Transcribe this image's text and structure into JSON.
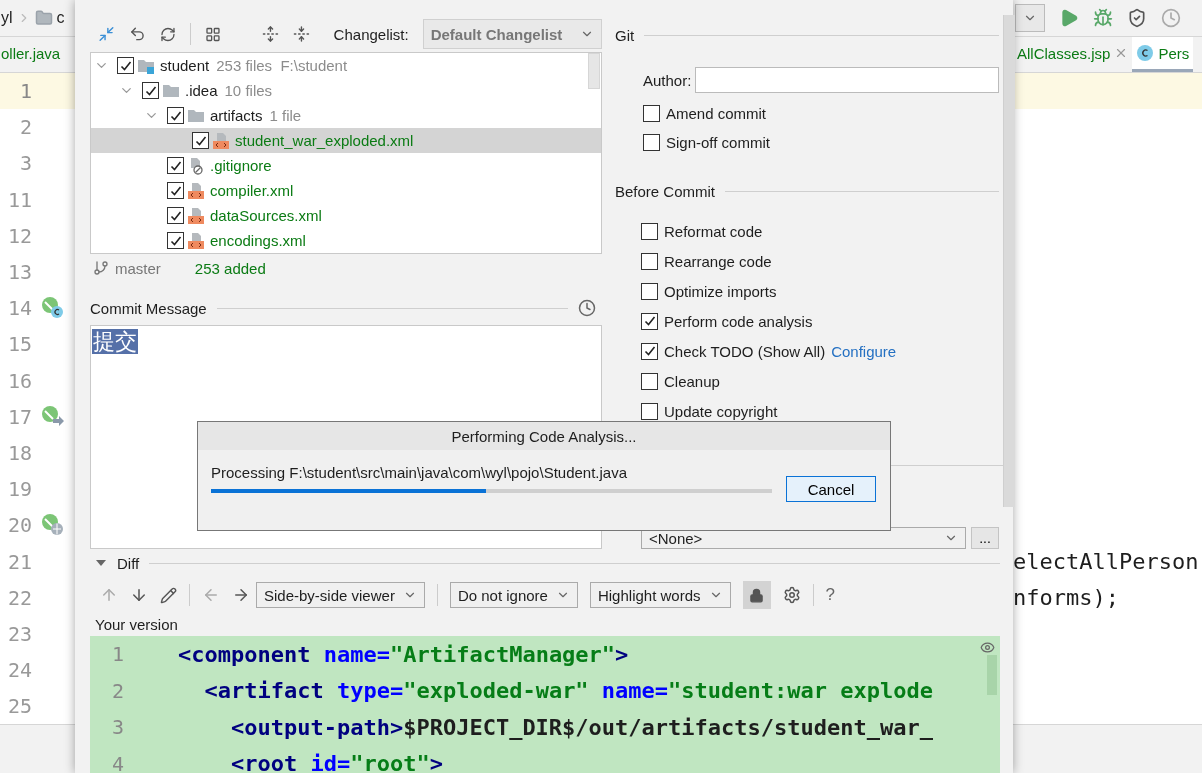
{
  "ide": {
    "breadcrumb": [
      {
        "label": "yl",
        "kind": "text"
      },
      {
        "label": "c",
        "kind": "folder"
      }
    ],
    "left_tab": "oller.java",
    "right_tabs": [
      {
        "label": "AllClasses.jsp",
        "selected": false,
        "closable": true
      },
      {
        "label": "Pers",
        "selected": true,
        "closable": false
      }
    ],
    "lines": [
      {
        "number": "1",
        "current": true
      },
      {
        "number": "2",
        "current": false
      },
      {
        "number": "3",
        "current": false
      },
      {
        "number": "11",
        "current": false
      },
      {
        "number": "12",
        "current": false
      },
      {
        "number": "13",
        "current": false
      },
      {
        "number": "14",
        "current": false,
        "kind": "class"
      },
      {
        "number": "15",
        "current": false
      },
      {
        "number": "16",
        "current": false
      },
      {
        "number": "17",
        "current": false,
        "kind": "implement"
      },
      {
        "number": "18",
        "current": false
      },
      {
        "number": "19",
        "current": false
      },
      {
        "number": "20",
        "current": false,
        "kind": "web"
      },
      {
        "number": "21",
        "current": false,
        "code": "electAllPerson"
      },
      {
        "number": "22",
        "current": false,
        "code": "nforms);"
      },
      {
        "number": "23",
        "current": false
      },
      {
        "number": "24",
        "current": false
      },
      {
        "number": "25",
        "current": false
      }
    ]
  },
  "commit": {
    "changelist_label": "Changelist:",
    "changelist": "Default Changelist",
    "tree": [
      {
        "name": "student",
        "info": "253 files  F:\\student",
        "kind": "module",
        "checked": true,
        "selected": false,
        "expanded": true,
        "children": [
          {
            "name": ".idea",
            "info": "10 files",
            "kind": "folder",
            "checked": true,
            "selected": false,
            "expanded": true,
            "children": [
              {
                "name": "artifacts",
                "info": "1 file",
                "kind": "folder",
                "checked": true,
                "selected": false,
                "expanded": true,
                "children": [
                  {
                    "name": "student_war_exploded.xml",
                    "kind": "xml",
                    "checked": true,
                    "selected": true
                  }
                ]
              },
              {
                "name": ".gitignore",
                "kind": "ignored",
                "checked": true,
                "selected": false
              },
              {
                "name": "compiler.xml",
                "kind": "xml",
                "checked": true,
                "selected": false
              },
              {
                "name": "dataSources.xml",
                "kind": "xml",
                "checked": true,
                "selected": false
              },
              {
                "name": "encodings.xml",
                "kind": "xml",
                "checked": true,
                "selected": false
              }
            ]
          }
        ]
      }
    ],
    "branch": "master",
    "summary": "253 added",
    "message_label": "Commit Message",
    "message": "提交",
    "git": {
      "title": "Git",
      "author_label": "Author:",
      "options": [
        {
          "label": "Amend commit",
          "checked": false
        },
        {
          "label": "Sign-off commit",
          "checked": false
        }
      ]
    },
    "before_commit": {
      "title": "Before Commit",
      "options": [
        {
          "label": "Reformat code",
          "checked": false
        },
        {
          "label": "Rearrange code",
          "checked": false
        },
        {
          "label": "Optimize imports",
          "checked": false
        },
        {
          "label": "Perform code analysis",
          "checked": true
        },
        {
          "label": "Check TODO (Show All)",
          "checked": true,
          "link": "Configure"
        },
        {
          "label": "Cleanup",
          "checked": false
        },
        {
          "label": "Update copyright",
          "checked": false
        }
      ]
    },
    "after_commit": {
      "dropdown": "<None>",
      "more_button": "..."
    },
    "diff": {
      "title": "Diff",
      "expanded": true,
      "viewer": "Side-by-side viewer",
      "ignore": "Do not ignore",
      "highlight": "Highlight words",
      "lock_on": true,
      "help": "?",
      "version_label": "Your version",
      "lines": [
        {
          "number": "1",
          "tokens": [
            {
              "kind": "tag",
              "text": "<component"
            },
            {
              "kind": "attr",
              "text": " name="
            },
            {
              "kind": "value",
              "text": "\"ArtifactManager\""
            },
            {
              "kind": "tag",
              "text": ">"
            }
          ]
        },
        {
          "number": "2",
          "tokens": [
            {
              "kind": "tag",
              "text": "  <artifact"
            },
            {
              "kind": "attr",
              "text": " type="
            },
            {
              "kind": "value",
              "text": "\"exploded-war\""
            },
            {
              "kind": "attr",
              "text": " name="
            },
            {
              "kind": "value",
              "text": "\"student:war explode"
            }
          ]
        },
        {
          "number": "3",
          "tokens": [
            {
              "kind": "tag",
              "text": "    <output-path>"
            },
            {
              "kind": "plain",
              "text": "$PROJECT_DIR$/out/artifacts/student_war_"
            }
          ]
        },
        {
          "number": "4",
          "tokens": [
            {
              "kind": "tag",
              "text": "    <root"
            },
            {
              "kind": "attr",
              "text": " id="
            },
            {
              "kind": "value",
              "text": "\"root\""
            },
            {
              "kind": "tag",
              "text": ">"
            }
          ]
        }
      ]
    }
  },
  "progress": {
    "title": "Performing Code Analysis...",
    "message": "Processing F:\\student\\src\\main\\java\\com\\wyl\\pojo\\Student.java",
    "level": 0.49,
    "cancel": "Cancel"
  }
}
